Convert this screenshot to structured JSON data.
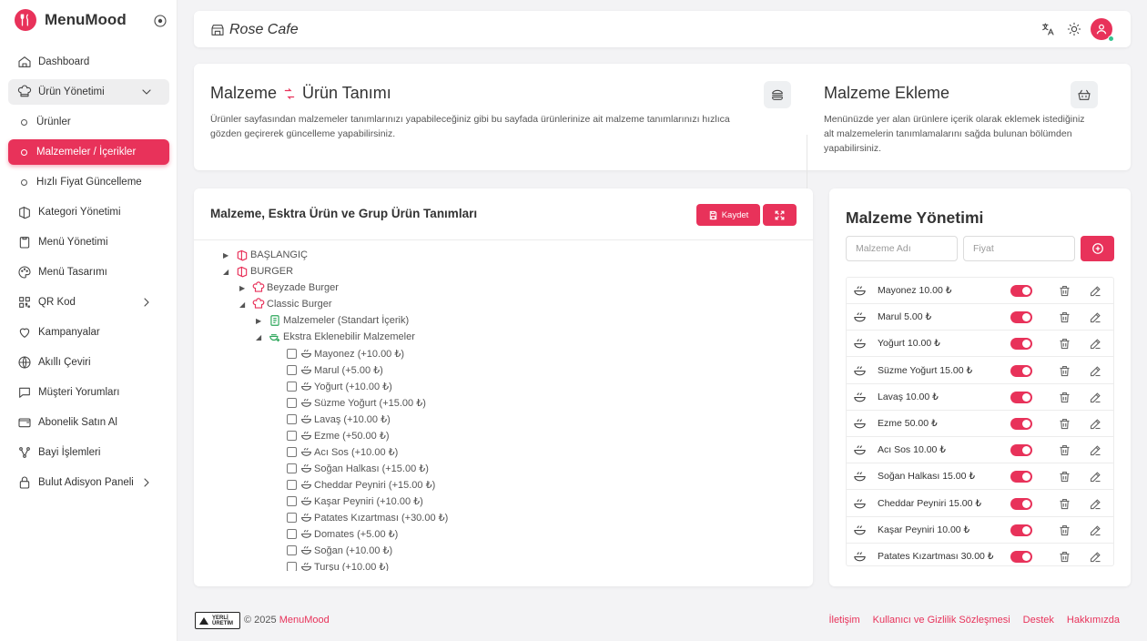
{
  "brand": {
    "name": "MenuMood"
  },
  "sidebar": {
    "items": [
      {
        "label": "Dashboard",
        "icon": "home-icon"
      },
      {
        "label": "Ürün Yönetimi",
        "icon": "chef-hat-icon"
      },
      {
        "label": "Ürünler",
        "icon": "circle-dot"
      },
      {
        "label": "Malzemeler / İçerikler",
        "icon": "circle-dot"
      },
      {
        "label": "Hızlı Fiyat Güncelleme",
        "icon": "circle-dot"
      },
      {
        "label": "Kategori Yönetimi",
        "icon": "category-icon"
      },
      {
        "label": "Menü Yönetimi",
        "icon": "clipboard-icon"
      },
      {
        "label": "Menü Tasarımı",
        "icon": "palette-icon"
      },
      {
        "label": "QR Kod",
        "icon": "qr-icon"
      },
      {
        "label": "Kampanyalar",
        "icon": "heart-icon"
      },
      {
        "label": "Akıllı Çeviri",
        "icon": "globe-icon"
      },
      {
        "label": "Müşteri Yorumları",
        "icon": "chat-icon"
      },
      {
        "label": "Abonelik Satın Al",
        "icon": "wallet-icon"
      },
      {
        "label": "Bayi İşlemleri",
        "icon": "network-icon"
      },
      {
        "label": "Bulut Adisyon Paneli",
        "icon": "cloud-icon"
      }
    ]
  },
  "topbar": {
    "store_name": "Rose Cafe"
  },
  "info": {
    "left_title_a": "Malzeme",
    "left_title_b": "Ürün Tanımı",
    "left_desc": "Ürünler sayfasından malzemeler tanımlarınızı yapabileceğiniz gibi bu sayfada ürünlerinize ait malzeme tanımlarınızı hızlıca gözden geçirerek güncelleme yapabilirsiniz.",
    "right_title": "Malzeme Ekleme",
    "right_desc": "Menünüzde yer alan ürünlere içerik olarak eklemek istediğiniz alt malzemelerin tanımlamalarını sağda bulunan bölümden yapabilirsiniz."
  },
  "tree": {
    "title": "Malzeme, Esktra Ürün ve Grup Ürün Tanımları",
    "save_label": "Kaydet",
    "nodes": [
      {
        "label": "BAŞLANGIÇ",
        "arrow": "▶"
      },
      {
        "label": "BURGER",
        "arrow": "◢"
      },
      {
        "label": "Beyzade Burger",
        "arrow": "▶"
      },
      {
        "label": "Classic Burger",
        "arrow": "◢"
      },
      {
        "label": "Malzemeler (Standart İçerik)",
        "arrow": "▶"
      },
      {
        "label": "Ekstra Eklenebilir Malzemeler",
        "arrow": "◢"
      }
    ],
    "extras": [
      "Mayonez (+10.00 ₺)",
      "Marul (+5.00 ₺)",
      "Yoğurt (+10.00 ₺)",
      "Süzme Yoğurt (+15.00 ₺)",
      "Lavaş (+10.00 ₺)",
      "Ezme (+50.00 ₺)",
      "Acı Sos (+10.00 ₺)",
      "Soğan Halkası (+15.00 ₺)",
      "Cheddar Peyniri (+15.00 ₺)",
      "Kaşar Peyniri (+10.00 ₺)",
      "Patates Kızartması (+30.00 ₺)",
      "Domates (+5.00 ₺)",
      "Soğan (+10.00 ₺)",
      "Turşu (+10.00 ₺)"
    ]
  },
  "manage": {
    "title": "Malzeme Yönetimi",
    "name_placeholder": "Malzeme Adı",
    "price_placeholder": "Fiyat",
    "items": [
      "Mayonez 10.00 ₺",
      "Marul 5.00 ₺",
      "Yoğurt 10.00 ₺",
      "Süzme Yoğurt 15.00 ₺",
      "Lavaş 10.00 ₺",
      "Ezme 50.00 ₺",
      "Acı Sos 10.00 ₺",
      "Soğan Halkası 15.00 ₺",
      "Cheddar Peyniri 15.00 ₺",
      "Kaşar Peyniri 10.00 ₺",
      "Patates Kızartması 30.00 ₺"
    ]
  },
  "footer": {
    "badge_line1": "YERLİ",
    "badge_line2": "ÜRETİM",
    "copyright": "© 2025",
    "brand_link": "MenuMood",
    "links": [
      "İletişim",
      "Kullanıcı ve Gizlilik Sözleşmesi",
      "Destek",
      "Hakkımızda"
    ]
  },
  "colors": {
    "accent": "#e8325a",
    "success": "#34c38f"
  }
}
